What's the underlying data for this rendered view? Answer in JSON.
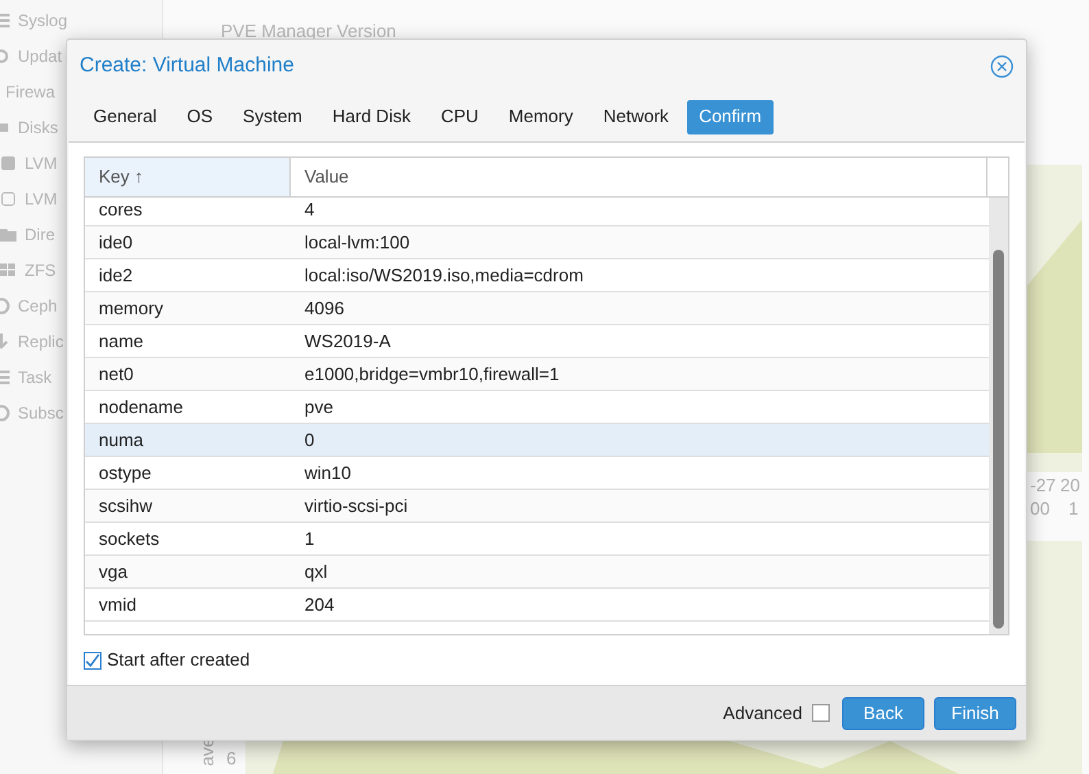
{
  "background": {
    "sidebar": [
      {
        "label": "Syslog",
        "kind": "list"
      },
      {
        "label": "Updat",
        "kind": "refresh"
      },
      {
        "label": "Firewa",
        "kind": "plain"
      },
      {
        "label": "Disks",
        "kind": "disk"
      },
      {
        "label": "LVM",
        "kind": "lvm"
      },
      {
        "label": "LVM",
        "kind": "lvmthin"
      },
      {
        "label": "Dire",
        "kind": "folder"
      },
      {
        "label": "ZFS",
        "kind": "zfs"
      },
      {
        "label": "Ceph",
        "kind": "circle"
      },
      {
        "label": "Replic",
        "kind": "arrow"
      },
      {
        "label": "Task",
        "kind": "list"
      },
      {
        "label": "Subsc",
        "kind": "circle"
      }
    ],
    "info_label": "PVE Manager Version",
    "chart_labels": {
      "x_date": "-27",
      "x_date_2": "20",
      "x_time": "00",
      "x_time_2": "1",
      "y_tick": "6",
      "y_label": "ave"
    }
  },
  "dialog": {
    "title": "Create: Virtual Machine",
    "tabs": [
      {
        "label": "General",
        "selected": false
      },
      {
        "label": "OS",
        "selected": false
      },
      {
        "label": "System",
        "selected": false
      },
      {
        "label": "Hard Disk",
        "selected": false
      },
      {
        "label": "CPU",
        "selected": false
      },
      {
        "label": "Memory",
        "selected": false
      },
      {
        "label": "Network",
        "selected": false
      },
      {
        "label": "Confirm",
        "selected": true
      }
    ],
    "table": {
      "columns": [
        "Key ↑",
        "Value"
      ],
      "rows": [
        {
          "key": "cores",
          "value": "4",
          "selected": false
        },
        {
          "key": "ide0",
          "value": "local-lvm:100",
          "selected": false
        },
        {
          "key": "ide2",
          "value": "local:iso/WS2019.iso,media=cdrom",
          "selected": false
        },
        {
          "key": "memory",
          "value": "4096",
          "selected": false
        },
        {
          "key": "name",
          "value": "WS2019-A",
          "selected": false
        },
        {
          "key": "net0",
          "value": "e1000,bridge=vmbr10,firewall=1",
          "selected": false
        },
        {
          "key": "nodename",
          "value": "pve",
          "selected": false
        },
        {
          "key": "numa",
          "value": "0",
          "selected": true
        },
        {
          "key": "ostype",
          "value": "win10",
          "selected": false
        },
        {
          "key": "scsihw",
          "value": "virtio-scsi-pci",
          "selected": false
        },
        {
          "key": "sockets",
          "value": "1",
          "selected": false
        },
        {
          "key": "vga",
          "value": "qxl",
          "selected": false
        },
        {
          "key": "vmid",
          "value": "204",
          "selected": false
        }
      ]
    },
    "start_after_created": {
      "label": "Start after created",
      "checked": true
    },
    "advanced": {
      "label": "Advanced",
      "checked": false
    },
    "buttons": [
      "Back",
      "Finish"
    ]
  }
}
